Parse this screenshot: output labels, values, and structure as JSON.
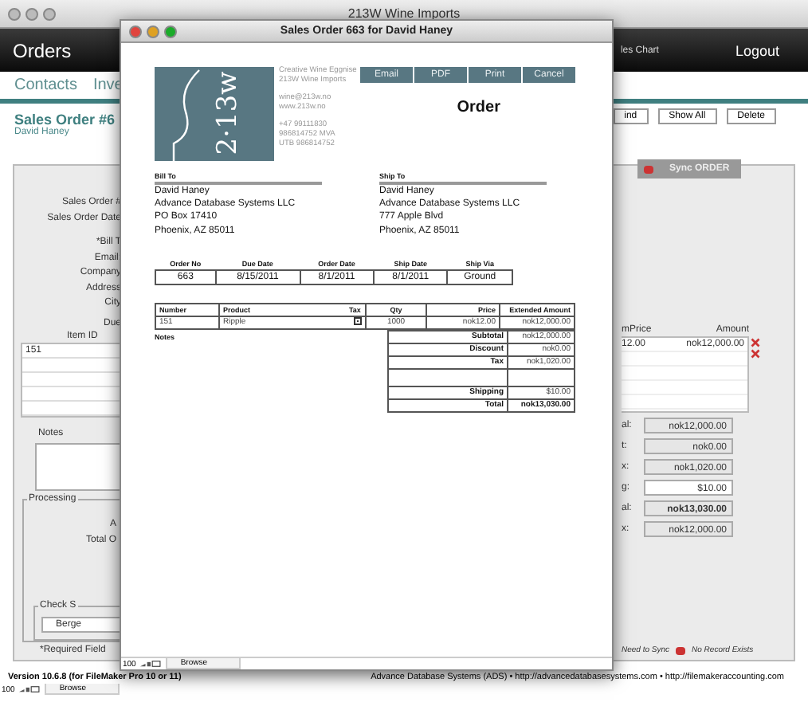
{
  "window": {
    "title": "213W Wine Imports"
  },
  "header": {
    "title": "Orders",
    "link": "les Chart",
    "logout": "Logout"
  },
  "nav": {
    "items": [
      "Contacts",
      "Inve"
    ]
  },
  "record": {
    "title": "Sales Order #6",
    "subtitle": "David Haney"
  },
  "toolbar": [
    "ind",
    "Show All",
    "Delete"
  ],
  "sync_button": "Sync ORDER",
  "form": {
    "labels": [
      "Sales Order #",
      "Sales Order Date",
      "*Bill T",
      "Email:",
      "Company",
      "Address",
      "City",
      "Due"
    ],
    "item_list": {
      "header": "Item ID",
      "rows": [
        "151"
      ]
    },
    "notes_label": "Notes",
    "processing": {
      "legend": "Processing",
      "labels": [
        "A",
        "Total O"
      ]
    },
    "check": {
      "legend": "Check S",
      "value": "Berge"
    },
    "required": "*Required Field"
  },
  "line_items": {
    "columns": [
      "mPrice",
      "Amount"
    ],
    "rows": [
      {
        "price": "12.00",
        "amount": "nok12,000.00"
      }
    ]
  },
  "totals": [
    {
      "label": "al:",
      "value": "nok12,000.00",
      "bold": false,
      "editable": false
    },
    {
      "label": "t:",
      "value": "nok0.00",
      "bold": false,
      "editable": false
    },
    {
      "label": "x:",
      "value": "nok1,020.00",
      "bold": false,
      "editable": false
    },
    {
      "label": "g:",
      "value": "$10.00",
      "bold": false,
      "editable": true
    },
    {
      "label": "al:",
      "value": "nok13,030.00",
      "bold": true,
      "editable": false
    },
    {
      "label": "x:",
      "value": "nok12,000.00",
      "bold": false,
      "editable": false
    }
  ],
  "legend": [
    "Need to Sync",
    "No Record Exists"
  ],
  "footer": {
    "version": "Version 10.6.8 (for FileMaker Pro 10 or 11)",
    "links": "Advance Database Systems (ADS) • http://advancedatabasesystems.com • http://filemakeraccounting.com"
  },
  "status_bar": {
    "zoom": "100",
    "mode": "Browse"
  },
  "dialog": {
    "title": "Sales Order 663 for David Haney",
    "logo_text": "2·13w",
    "company": [
      "Creative Wine Eggnise",
      "213W Wine Imports",
      "wine@213w.no",
      "www.213w.no",
      "+47 99111830",
      "986814752 MVA",
      "UTB 986814752"
    ],
    "buttons": [
      "Email",
      "PDF",
      "Print",
      "Cancel"
    ],
    "heading": "Order",
    "bill_to": {
      "label": "Bill To",
      "lines": [
        "David Haney",
        "Advance Database Systems LLC",
        "PO Box 17410",
        "Phoenix, AZ 85011"
      ]
    },
    "ship_to": {
      "label": "Ship To",
      "lines": [
        "David Haney",
        "Advance Database Systems LLC",
        "777 Apple Blvd",
        "Phoenix, AZ 85011"
      ]
    },
    "order_info": {
      "columns": [
        "Order No",
        "Due Date",
        "Order Date",
        "Ship Date",
        "Ship Via"
      ],
      "values": [
        "663",
        "8/15/2011",
        "8/1/2011",
        "8/1/2011",
        "Ground"
      ]
    },
    "items": {
      "columns": [
        "Number",
        "Product",
        "Tax",
        "Qty",
        "Price",
        "Extended Amount"
      ],
      "rows": [
        {
          "number": "151",
          "product": "Ripple",
          "tax": true,
          "qty": "1000",
          "price": "nok12.00",
          "amount": "nok12,000.00"
        }
      ]
    },
    "notes_label": "Notes",
    "totals": [
      {
        "kind": "line",
        "label": "Subtotal",
        "value": "nok12,000.00",
        "bold": false
      },
      {
        "kind": "line",
        "label": "Discount",
        "value": "nok0.00",
        "bold": false
      },
      {
        "kind": "line",
        "label": "Tax",
        "value": "nok1,020.00",
        "bold": false
      },
      {
        "kind": "blank"
      },
      {
        "kind": "line",
        "label": "Shipping",
        "value": "$10.00",
        "bold": false
      },
      {
        "kind": "line",
        "label": "Total",
        "value": "nok13,030.00",
        "bold": true
      }
    ],
    "status_bar": {
      "zoom": "100",
      "mode": "Browse"
    }
  }
}
